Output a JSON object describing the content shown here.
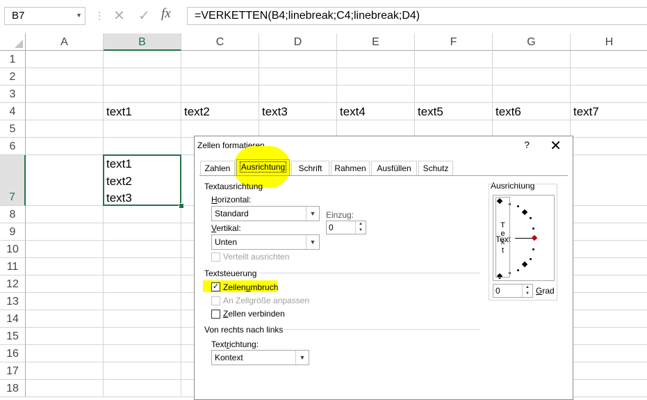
{
  "formula_bar": {
    "name_box": "B7",
    "dots": "⋮",
    "cancel": "✕",
    "enter": "✓",
    "fx": "fx",
    "formula": "=VERKETTEN(B4;linebreak;C4;linebreak;D4)"
  },
  "columns": [
    "A",
    "B",
    "C",
    "D",
    "E",
    "F",
    "G",
    "H"
  ],
  "rows": [
    "1",
    "2",
    "3",
    "4",
    "5",
    "6",
    "7",
    "8",
    "9",
    "10",
    "11",
    "12",
    "13",
    "14",
    "15",
    "16",
    "17",
    "18"
  ],
  "cells": {
    "B4": "text1",
    "C4": "text2",
    "D4": "text3",
    "E4": "text4",
    "F4": "text5",
    "G4": "text6",
    "H4": "text7",
    "B7": "text1\ntext2\ntext3"
  },
  "dialog": {
    "title": "Zellen formatieren",
    "help": "?",
    "close": "✕",
    "tabs": [
      "Zahlen",
      "Ausrichtung",
      "Schrift",
      "Rahmen",
      "Ausfüllen",
      "Schutz"
    ],
    "active_tab": "Ausrichtung",
    "text_alignment": {
      "group": "Textausrichtung",
      "horizontal_label": "Horizontal:",
      "horizontal_value": "Standard",
      "indent_label": "Einzug:",
      "indent_value": "0",
      "vertical_label": "Vertikal:",
      "vertical_value": "Unten",
      "distributed_label": "Verteilt ausrichten"
    },
    "text_control": {
      "group": "Textsteuerung",
      "wrap_label": "Zeilenumbruch",
      "wrap_checked": true,
      "shrink_label": "An Zellgröße anpassen",
      "shrink_checked": false,
      "merge_label": "Zellen verbinden",
      "merge_checked": false
    },
    "rtl": {
      "group": "Von rechts nach links",
      "direction_label": "Textrichtung:",
      "direction_value": "Kontext"
    },
    "orientation": {
      "group": "Ausrichtung",
      "vertical_text": [
        "T",
        "e",
        "x",
        "t"
      ],
      "text_label": "Text",
      "degrees_value": "0",
      "degrees_label": "Grad"
    },
    "highlight_color": "#ffff00"
  }
}
